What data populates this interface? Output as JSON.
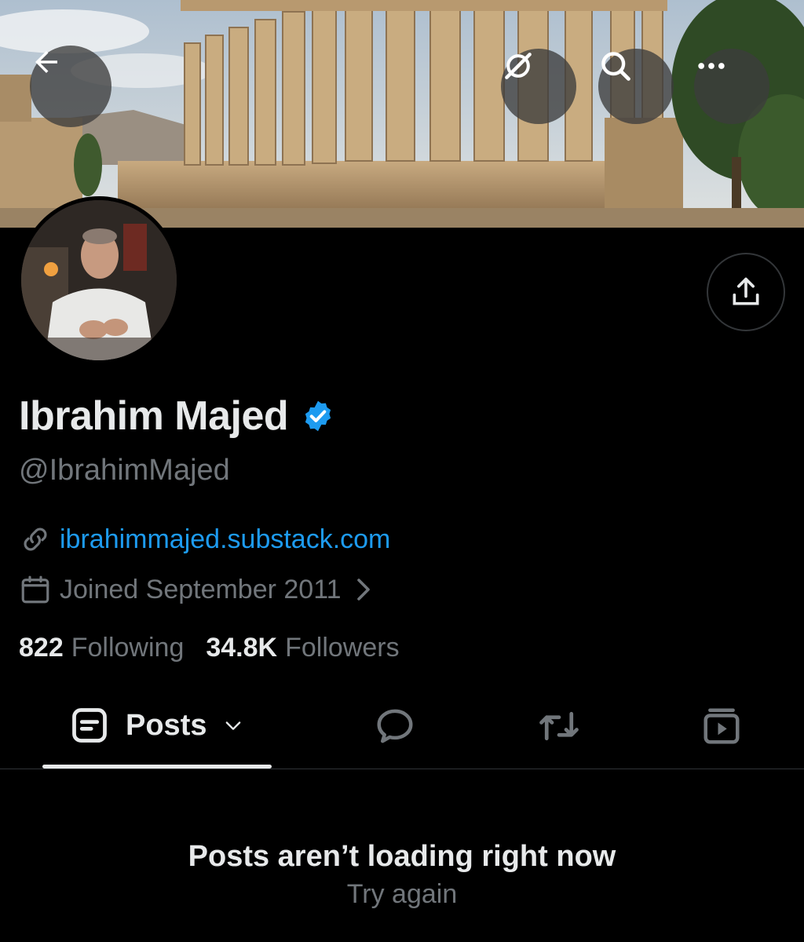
{
  "profile": {
    "name": "Ibrahim Majed",
    "handle": "@IbrahimMajed",
    "website": "ibrahimmajed.substack.com",
    "joined": "Joined September 2011",
    "following_count": "822",
    "following_label": "Following",
    "followers_count": "34.8K",
    "followers_label": "Followers"
  },
  "tabs": {
    "posts_label": "Posts"
  },
  "feed": {
    "error_title": "Posts aren’t loading right now",
    "retry_label": "Try again"
  },
  "colors": {
    "accent": "#1d9bf0",
    "text_primary": "#e7e9ea",
    "text_secondary": "#71767b",
    "background": "#000000"
  },
  "icons": {
    "back": "arrow-left-icon",
    "grok": "grok-icon",
    "search": "search-icon",
    "more": "more-horizontal-icon",
    "share": "share-icon",
    "verified": "verified-badge-icon",
    "link": "link-icon",
    "calendar": "calendar-icon",
    "posts": "posts-icon",
    "replies": "reply-bubble-icon",
    "reposts": "repost-icon",
    "media": "media-icon"
  }
}
